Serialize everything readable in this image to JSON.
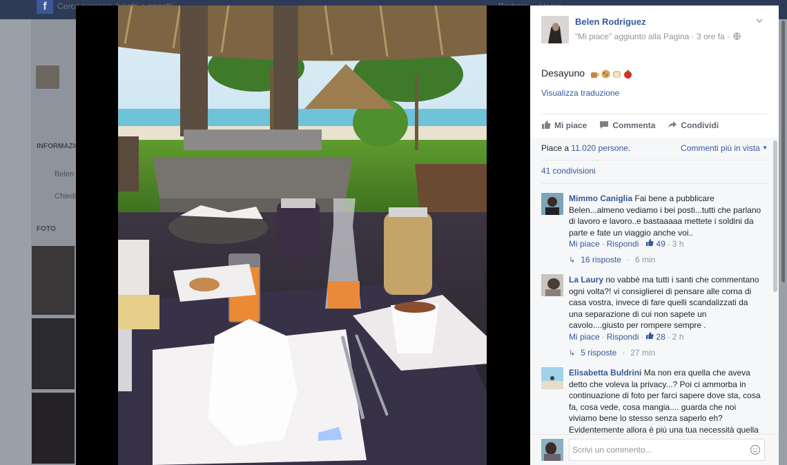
{
  "background": {
    "search_placeholder": "Cerca persone, luoghi e oggetti",
    "user_name": "Barbara",
    "home": "Home",
    "info_section": "INFORMAZIONI",
    "info_name": "Belen",
    "info_ask": "Chiedi",
    "photos_section": "FOTO"
  },
  "post": {
    "author": "Belen Rodriguez",
    "meta": "\"Mi piace\" aggiunto alla Pagina · 3 ore fa ·",
    "text": "Desayuno",
    "translate": "Visualizza traduzione"
  },
  "actions": {
    "like": "Mi piace",
    "comment": "Commenta",
    "share": "Condividi"
  },
  "feedback": {
    "likes_prefix": "Piace a ",
    "likes_count": "11.020 persone",
    "likes_suffix": ".",
    "sort": "Commenti più in vista",
    "shares": "41 condivisioni"
  },
  "comments": [
    {
      "name": "Mimmo Caniglia",
      "text": "Fai bene a pubblicare Belen...almeno vediamo i bei posti...tutti che parlano di lavoro e lavoro..e bastaaaaa mettete i soldini da parte e fate un viaggio anche voi..",
      "like": "Mi piace",
      "reply": "Rispondi",
      "likes": "49",
      "time": "3 h",
      "replies": "16 risposte",
      "replies_time": "6 min"
    },
    {
      "name": "La Laury",
      "text": "no vabbè ma tutti i santi che commentano ogni volta?! vi consiglierei di pensare alle corna di casa vostra, invece di fare quelli scandalizzati da una separazione di cui non sapete un cavolo....giusto per rompere sempre .",
      "like": "Mi piace",
      "reply": "Rispondi",
      "likes": "28",
      "time": "2 h",
      "replies": "5 risposte",
      "replies_time": "27 min"
    },
    {
      "name": "Elisabetta Buldrini",
      "text": "Ma non era quella che aveva detto che voleva la privacy...? Poi ci ammorba in continuazione di foto per farci sapere dove sta, cosa fa, cosa vede, cosa mangia.... guarda che noi viviamo bene lo stesso senza saperlo eh? Evidentemente allora è più una tua necessità quella di voler essere sempre \"visibile\"... coerenza, Belen..."
    }
  ],
  "composer": {
    "placeholder": "Scrivi un commento..."
  },
  "colors": {
    "link": "#365899",
    "muted": "#90949c",
    "panel_bg": "#f6f7f9"
  }
}
